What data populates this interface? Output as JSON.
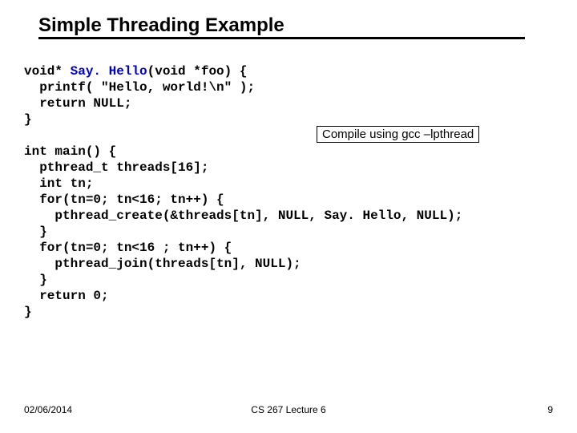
{
  "title": "Simple Threading Example",
  "callout": "Compile using gcc –lpthread",
  "code": {
    "l1a": "void* ",
    "l1fn": "Say. Hello",
    "l1b": "(void *foo) {",
    "l2": "  printf( \"Hello, world!\\n\" );",
    "l3": "  return NULL;",
    "l4": "}",
    "l5": "",
    "l6": "int main() {",
    "l7": "  pthread_t threads[16];",
    "l8": "  int tn;",
    "l9": "  for(tn=0; tn<16; tn++) {",
    "l10": "    pthread_create(&threads[tn], NULL, Say. Hello, NULL);",
    "l11": "  }",
    "l12": "  for(tn=0; tn<16 ; tn++) {",
    "l13": "    pthread_join(threads[tn], NULL);",
    "l14": "  }",
    "l15": "  return 0;",
    "l16": "}"
  },
  "footer": {
    "date": "02/06/2014",
    "center": "CS 267 Lecture 6",
    "page": "9"
  }
}
